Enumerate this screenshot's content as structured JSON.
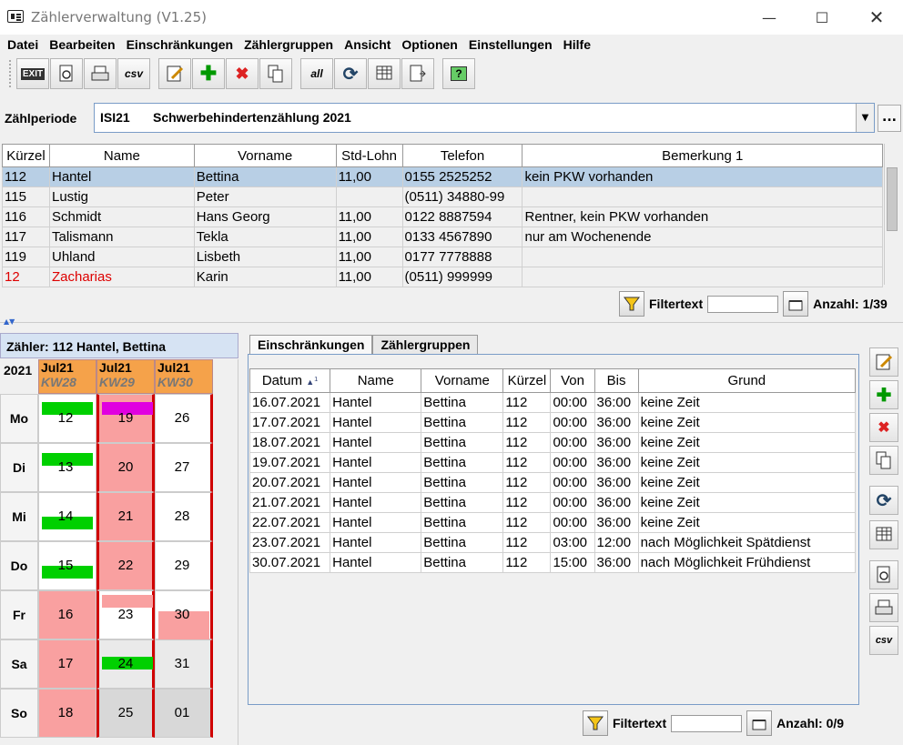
{
  "window": {
    "title": "Zählerverwaltung (V1.25)"
  },
  "menu": [
    "Datei",
    "Bearbeiten",
    "Einschränkungen",
    "Zählergruppen",
    "Ansicht",
    "Optionen",
    "Einstellungen",
    "Hilfe"
  ],
  "toolbar": {
    "exit_label": "EXIT",
    "csv_label": "csv",
    "all_label": "all"
  },
  "zaehlperiode": {
    "label": "Zählperiode",
    "code": "ISI21",
    "name": "Schwerbehindertenzählung 2021",
    "more_label": "..."
  },
  "counters_table": {
    "columns": [
      "Kürzel",
      "Name",
      "Vorname",
      "Std-Lohn",
      "Telefon",
      "Bemerkung 1"
    ],
    "rows": [
      [
        "112",
        "Hantel",
        "Bettina",
        "11,00",
        "0155 2525252",
        "kein PKW vorhanden"
      ],
      [
        "115",
        "Lustig",
        "Peter",
        "",
        "(0511) 34880-99",
        ""
      ],
      [
        "116",
        "Schmidt",
        "Hans Georg",
        "11,00",
        "0122 8887594",
        "Rentner, kein PKW vorhanden"
      ],
      [
        "117",
        "Talismann",
        "Tekla",
        "11,00",
        "0133 4567890",
        "nur am Wochenende"
      ],
      [
        "119",
        "Uhland",
        "Lisbeth",
        "11,00",
        "0177  7778888",
        ""
      ],
      [
        "12",
        "Zacharias",
        "Karin",
        "11,00",
        "(0511)  999999",
        ""
      ]
    ]
  },
  "filter_top": {
    "label": "Filtertext",
    "value": "",
    "count": "Anzahl: 1/39"
  },
  "calendar": {
    "title": "Zähler: 112 Hantel, Bettina",
    "year": "2021",
    "weeks": [
      {
        "month": "Jul21",
        "kw": "KW28"
      },
      {
        "month": "Jul21",
        "kw": "KW29"
      },
      {
        "month": "Jul21",
        "kw": "KW30"
      }
    ],
    "days": [
      "Mo",
      "Di",
      "Mi",
      "Do",
      "Fr",
      "Sa",
      "So"
    ],
    "dates": [
      [
        "12",
        "19",
        "26"
      ],
      [
        "13",
        "20",
        "27"
      ],
      [
        "14",
        "21",
        "28"
      ],
      [
        "15",
        "22",
        "29"
      ],
      [
        "16",
        "23",
        "30"
      ],
      [
        "17",
        "24",
        "31"
      ],
      [
        "18",
        "25",
        "01"
      ]
    ]
  },
  "tabs": [
    "Einschränkungen",
    "Zählergruppen"
  ],
  "restrictions_table": {
    "columns": [
      "Datum",
      "Name",
      "Vorname",
      "Kürzel",
      "Von",
      "Bis",
      "Grund"
    ],
    "sort_indicator": "1",
    "rows": [
      [
        "16.07.2021",
        "Hantel",
        "Bettina",
        "112",
        "00:00",
        "36:00",
        "keine Zeit"
      ],
      [
        "17.07.2021",
        "Hantel",
        "Bettina",
        "112",
        "00:00",
        "36:00",
        "keine Zeit"
      ],
      [
        "18.07.2021",
        "Hantel",
        "Bettina",
        "112",
        "00:00",
        "36:00",
        "keine Zeit"
      ],
      [
        "19.07.2021",
        "Hantel",
        "Bettina",
        "112",
        "00:00",
        "36:00",
        "keine Zeit"
      ],
      [
        "20.07.2021",
        "Hantel",
        "Bettina",
        "112",
        "00:00",
        "36:00",
        "keine Zeit"
      ],
      [
        "21.07.2021",
        "Hantel",
        "Bettina",
        "112",
        "00:00",
        "36:00",
        "keine Zeit"
      ],
      [
        "22.07.2021",
        "Hantel",
        "Bettina",
        "112",
        "00:00",
        "36:00",
        "keine Zeit"
      ],
      [
        "23.07.2021",
        "Hantel",
        "Bettina",
        "112",
        "03:00",
        "12:00",
        "nach Möglichkeit Spätdienst"
      ],
      [
        "30.07.2021",
        "Hantel",
        "Bettina",
        "112",
        "15:00",
        "36:00",
        "nach Möglichkeit Frühdienst"
      ]
    ]
  },
  "filter_bottom": {
    "label": "Filtertext",
    "value": "",
    "count": "Anzahl: 0/9"
  },
  "colors": {
    "selection": "#b8cfe5",
    "week_header": "#f5a24a",
    "busy": "#f9a0a0",
    "free_green": "#00d000",
    "magenta": "#e000e0",
    "red_line": "#d00000"
  }
}
